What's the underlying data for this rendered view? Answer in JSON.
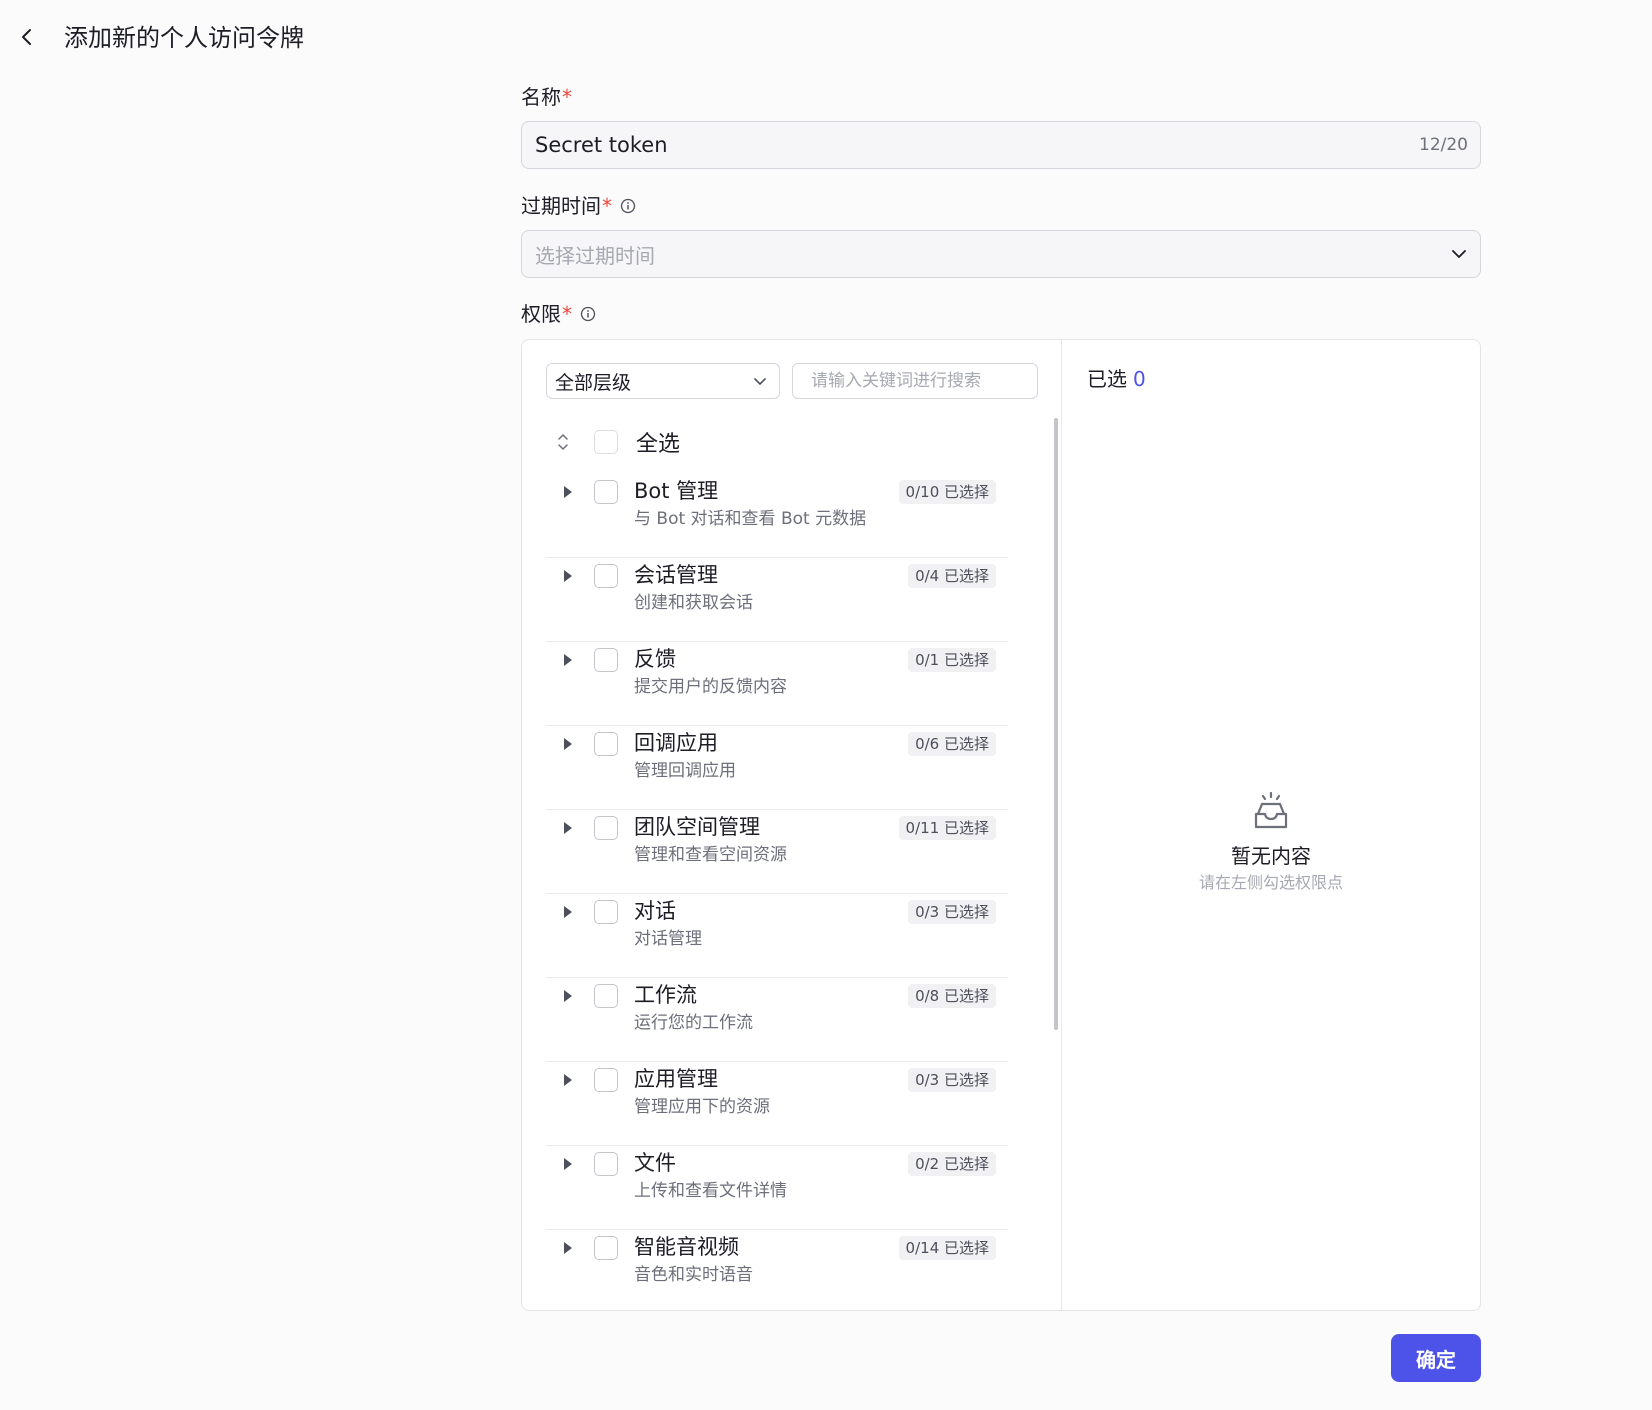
{
  "header": {
    "title": "添加新的个人访问令牌",
    "back_icon": "chevron-left-icon"
  },
  "form": {
    "name": {
      "label": "名称",
      "required_mark": "*",
      "value": "Secret token",
      "counter": "12/20"
    },
    "expire": {
      "label": "过期时间",
      "required_mark": "*",
      "placeholder": "选择过期时间"
    },
    "permission": {
      "label": "权限",
      "required_mark": "*",
      "level_select": "全部层级",
      "search_placeholder": "请输入关键词进行搜索",
      "select_all": "全选",
      "items": [
        {
          "title": "Bot 管理",
          "desc": "与 Bot 对话和查看 Bot 元数据",
          "badge": "0/10 已选择"
        },
        {
          "title": "会话管理",
          "desc": "创建和获取会话",
          "badge": "0/4 已选择"
        },
        {
          "title": "反馈",
          "desc": "提交用户的反馈内容",
          "badge": "0/1 已选择"
        },
        {
          "title": "回调应用",
          "desc": "管理回调应用",
          "badge": "0/6 已选择"
        },
        {
          "title": "团队空间管理",
          "desc": "管理和查看空间资源",
          "badge": "0/11 已选择"
        },
        {
          "title": "对话",
          "desc": "对话管理",
          "badge": "0/3 已选择"
        },
        {
          "title": "工作流",
          "desc": "运行您的工作流",
          "badge": "0/8 已选择"
        },
        {
          "title": "应用管理",
          "desc": "管理应用下的资源",
          "badge": "0/3 已选择"
        },
        {
          "title": "文件",
          "desc": "上传和查看文件详情",
          "badge": "0/2 已选择"
        },
        {
          "title": "智能音视频",
          "desc": "音色和实时语音",
          "badge": "0/14 已选择"
        }
      ],
      "selected": {
        "label": "已选",
        "count": "0"
      },
      "empty": {
        "title": "暂无内容",
        "desc": "请在左侧勾选权限点"
      }
    }
  },
  "footer": {
    "confirm_label": "确定"
  },
  "colors": {
    "accent": "#4d53e8",
    "required": "#f0453a",
    "border": "#d5d6dc"
  }
}
